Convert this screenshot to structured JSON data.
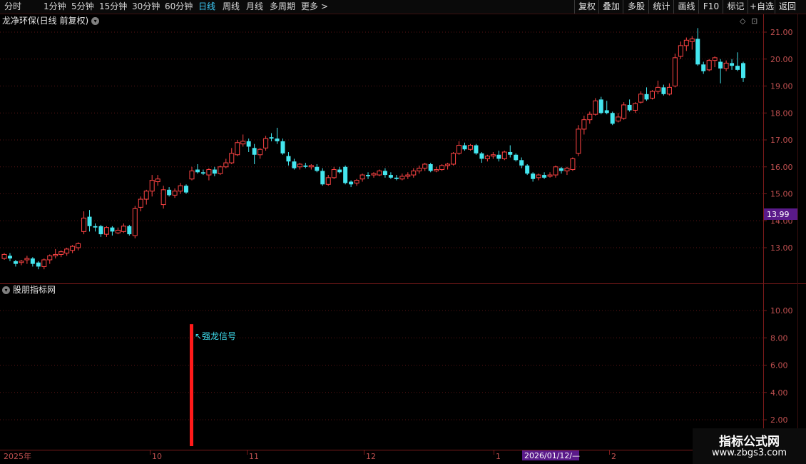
{
  "toolbar": {
    "periods": [
      "分时",
      "1分钟",
      "5分钟",
      "15分钟",
      "30分钟",
      "60分钟",
      "日线",
      "周线",
      "月线",
      "多周期",
      "更多 >"
    ],
    "active": "日线",
    "right_buttons": [
      "复权",
      "叠加",
      "多股",
      "统计",
      "画线",
      "F10",
      "标记",
      "+自选",
      "返回"
    ]
  },
  "main_chart": {
    "title": "龙净环保(日线 前复权)",
    "price_ticks": [
      "21.00",
      "20.00",
      "19.00",
      "18.00",
      "17.00",
      "16.00",
      "15.00",
      "14.00",
      "13.00"
    ],
    "current_price": "13.99",
    "up_color": "#ff4444",
    "down_color": "#44e6ef"
  },
  "sub_chart": {
    "title": "股朋指标网",
    "ticks": [
      "10.00",
      "8.00",
      "6.00",
      "4.00",
      "2.00"
    ],
    "signal_label": "↖强龙信号",
    "signal_value": 9,
    "signal_color": "#ff1a1a"
  },
  "time_axis": {
    "labels": [
      "2025年",
      "10",
      "11",
      "12",
      "1",
      "2"
    ],
    "cursor_date": "2026/01/12/—"
  },
  "candles": [
    [
      12.6,
      12.75,
      12.8,
      12.55
    ],
    [
      12.7,
      12.6,
      12.8,
      12.5
    ],
    [
      12.5,
      12.4,
      12.55,
      12.3
    ],
    [
      12.45,
      12.5,
      12.55,
      12.35
    ],
    [
      12.55,
      12.6,
      12.7,
      12.4
    ],
    [
      12.6,
      12.4,
      12.65,
      12.3
    ],
    [
      12.45,
      12.3,
      12.5,
      12.2
    ],
    [
      12.3,
      12.55,
      12.6,
      12.2
    ],
    [
      12.55,
      12.7,
      12.75,
      12.4
    ],
    [
      12.7,
      12.75,
      12.95,
      12.6
    ],
    [
      12.75,
      12.85,
      12.9,
      12.65
    ],
    [
      12.8,
      12.95,
      13.0,
      12.7
    ],
    [
      12.9,
      13.05,
      13.1,
      12.8
    ],
    [
      13.0,
      13.15,
      13.2,
      12.9
    ],
    [
      13.6,
      14.1,
      14.35,
      13.5
    ],
    [
      14.15,
      13.8,
      14.4,
      13.6
    ],
    [
      13.8,
      13.75,
      13.9,
      13.6
    ],
    [
      13.8,
      13.5,
      13.85,
      13.4
    ],
    [
      13.5,
      13.75,
      13.8,
      13.4
    ],
    [
      13.75,
      13.6,
      13.8,
      13.45
    ],
    [
      13.55,
      13.65,
      13.75,
      13.5
    ],
    [
      13.6,
      13.8,
      13.9,
      13.55
    ],
    [
      13.8,
      13.5,
      13.85,
      13.45
    ],
    [
      13.45,
      14.45,
      14.55,
      13.35
    ],
    [
      14.5,
      14.8,
      14.9,
      14.35
    ],
    [
      14.8,
      15.1,
      15.15,
      14.6
    ],
    [
      15.1,
      15.5,
      15.7,
      14.9
    ],
    [
      15.45,
      15.55,
      15.7,
      15.3
    ],
    [
      14.6,
      15.15,
      15.3,
      14.45
    ],
    [
      15.15,
      14.95,
      15.25,
      14.9
    ],
    [
      14.95,
      15.1,
      15.2,
      14.85
    ],
    [
      15.1,
      15.3,
      15.4,
      15.0
    ],
    [
      15.3,
      15.05,
      15.35,
      15.0
    ],
    [
      15.55,
      15.85,
      16.0,
      15.5
    ],
    [
      15.9,
      15.8,
      16.1,
      15.75
    ],
    [
      15.8,
      15.75,
      15.9,
      15.7
    ],
    [
      15.7,
      15.9,
      15.95,
      15.5
    ],
    [
      15.9,
      15.75,
      16.0,
      15.65
    ],
    [
      15.75,
      16.0,
      16.05,
      15.7
    ],
    [
      16.0,
      16.15,
      16.3,
      15.95
    ],
    [
      16.15,
      16.5,
      16.7,
      16.1
    ],
    [
      16.45,
      16.9,
      17.0,
      16.4
    ],
    [
      16.85,
      16.95,
      17.2,
      16.75
    ],
    [
      16.95,
      16.75,
      17.05,
      16.55
    ],
    [
      16.7,
      16.45,
      16.85,
      16.1
    ],
    [
      16.45,
      16.65,
      16.7,
      16.3
    ],
    [
      16.7,
      17.05,
      17.15,
      16.6
    ],
    [
      17.1,
      17.05,
      17.25,
      16.95
    ],
    [
      17.05,
      16.95,
      17.45,
      16.85
    ],
    [
      16.95,
      16.5,
      17.05,
      16.45
    ],
    [
      16.4,
      16.2,
      16.55,
      16.05
    ],
    [
      16.2,
      15.95,
      16.3,
      15.9
    ],
    [
      16.0,
      16.1,
      16.15,
      15.9
    ],
    [
      16.05,
      16.0,
      16.15,
      15.95
    ],
    [
      16.0,
      16.05,
      16.1,
      15.9
    ],
    [
      16.0,
      15.85,
      16.1,
      15.8
    ],
    [
      15.85,
      15.35,
      15.95,
      15.3
    ],
    [
      15.35,
      15.6,
      15.7,
      15.3
    ],
    [
      15.6,
      15.9,
      16.0,
      15.55
    ],
    [
      15.9,
      15.8,
      16.0,
      15.75
    ],
    [
      16.0,
      15.4,
      16.05,
      15.35
    ],
    [
      15.45,
      15.35,
      15.5,
      15.25
    ],
    [
      15.4,
      15.5,
      15.55,
      15.3
    ],
    [
      15.55,
      15.7,
      15.75,
      15.45
    ],
    [
      15.7,
      15.65,
      15.8,
      15.55
    ],
    [
      15.7,
      15.75,
      15.8,
      15.6
    ],
    [
      15.7,
      15.85,
      15.9,
      15.65
    ],
    [
      15.85,
      15.7,
      15.95,
      15.6
    ],
    [
      15.7,
      15.6,
      15.8,
      15.55
    ],
    [
      15.6,
      15.55,
      15.7,
      15.5
    ],
    [
      15.55,
      15.65,
      15.75,
      15.5
    ],
    [
      15.65,
      15.7,
      15.8,
      15.55
    ],
    [
      15.7,
      15.85,
      15.95,
      15.6
    ],
    [
      15.85,
      15.95,
      16.05,
      15.75
    ],
    [
      15.95,
      16.1,
      16.15,
      15.85
    ],
    [
      16.1,
      15.85,
      16.15,
      15.8
    ],
    [
      15.85,
      15.9,
      16.0,
      15.8
    ],
    [
      15.9,
      16.05,
      16.1,
      15.85
    ],
    [
      16.05,
      16.1,
      16.15,
      15.9
    ],
    [
      16.1,
      16.5,
      16.55,
      16.05
    ],
    [
      16.5,
      16.8,
      16.95,
      16.45
    ],
    [
      16.8,
      16.65,
      16.9,
      16.6
    ],
    [
      16.65,
      16.8,
      16.85,
      16.6
    ],
    [
      16.8,
      16.5,
      16.85,
      16.45
    ],
    [
      16.5,
      16.3,
      16.55,
      16.15
    ],
    [
      16.3,
      16.4,
      16.45,
      16.2
    ],
    [
      16.4,
      16.45,
      16.55,
      16.3
    ],
    [
      16.45,
      16.3,
      16.6,
      16.2
    ],
    [
      16.3,
      16.55,
      16.6,
      16.25
    ],
    [
      16.55,
      16.45,
      16.8,
      16.35
    ],
    [
      16.45,
      16.25,
      16.5,
      16.2
    ],
    [
      16.25,
      16.05,
      16.35,
      15.95
    ],
    [
      16.05,
      15.75,
      16.1,
      15.7
    ],
    [
      15.75,
      15.55,
      15.8,
      15.45
    ],
    [
      15.6,
      15.7,
      15.75,
      15.5
    ],
    [
      15.7,
      15.6,
      15.8,
      15.55
    ],
    [
      15.65,
      15.7,
      15.8,
      15.6
    ],
    [
      15.7,
      16.0,
      16.05,
      15.6
    ],
    [
      15.95,
      15.85,
      16.0,
      15.75
    ],
    [
      15.85,
      15.95,
      16.0,
      15.7
    ],
    [
      15.9,
      16.3,
      16.35,
      15.85
    ],
    [
      16.5,
      17.4,
      17.55,
      16.4
    ],
    [
      17.4,
      17.75,
      17.9,
      17.2
    ],
    [
      17.75,
      17.95,
      18.05,
      17.6
    ],
    [
      17.95,
      18.45,
      18.55,
      17.9
    ],
    [
      18.5,
      18.0,
      18.6,
      17.95
    ],
    [
      18.1,
      18.0,
      18.45,
      17.95
    ],
    [
      18.0,
      17.6,
      18.05,
      17.55
    ],
    [
      17.7,
      17.85,
      18.0,
      17.65
    ],
    [
      17.8,
      18.3,
      18.4,
      17.75
    ],
    [
      18.3,
      18.1,
      18.5,
      18.05
    ],
    [
      18.1,
      18.35,
      18.4,
      18.0
    ],
    [
      18.4,
      18.7,
      18.8,
      18.35
    ],
    [
      18.7,
      18.5,
      18.95,
      18.45
    ],
    [
      18.55,
      18.8,
      18.85,
      18.5
    ],
    [
      18.8,
      18.95,
      19.2,
      18.7
    ],
    [
      18.95,
      18.7,
      19.05,
      18.65
    ],
    [
      18.7,
      18.95,
      19.1,
      18.65
    ],
    [
      19.0,
      20.05,
      20.2,
      18.95
    ],
    [
      20.1,
      20.5,
      20.65,
      20.0
    ],
    [
      20.5,
      20.7,
      20.8,
      20.3
    ],
    [
      20.65,
      20.75,
      20.85,
      20.35
    ],
    [
      20.75,
      19.8,
      21.15,
      19.75
    ],
    [
      19.8,
      19.55,
      19.9,
      19.45
    ],
    [
      19.6,
      19.95,
      20.0,
      19.55
    ],
    [
      19.95,
      20.05,
      20.1,
      19.7
    ],
    [
      19.9,
      19.65,
      20.0,
      19.1
    ],
    [
      19.65,
      19.85,
      19.95,
      19.55
    ],
    [
      19.85,
      19.75,
      20.0,
      19.6
    ],
    [
      19.75,
      19.6,
      20.25,
      19.55
    ],
    [
      19.85,
      19.3,
      19.9,
      19.15
    ]
  ]
}
